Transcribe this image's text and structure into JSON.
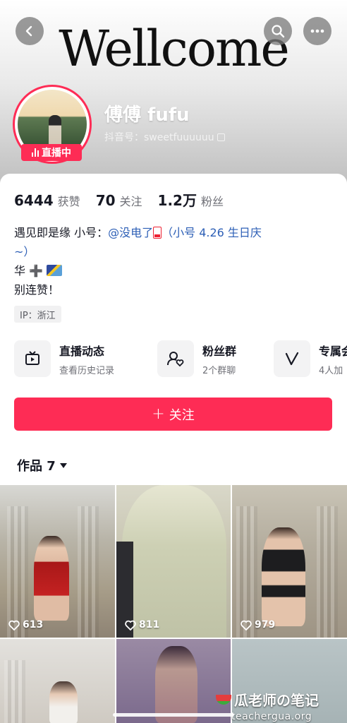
{
  "header": {
    "banner_title": "Wellcome",
    "nickname": "傅傅 fufu",
    "douyin_id": "抖音号：sweetfuuuuuu",
    "live_badge": "直播中"
  },
  "stats": {
    "likes_num": "6444",
    "likes_label": "获赞",
    "following_num": "70",
    "following_label": "关注",
    "followers_num": "1.2万",
    "followers_label": "粉丝"
  },
  "bio": {
    "line1_prefix": "遇见即是缘 小号：",
    "line1_mention": "@没电了",
    "line1_suffix": "（小号 4.26 生日庆",
    "line2": "~）",
    "line3": "华 ➕",
    "line4": "别连赞！"
  },
  "ip_tag": "IP：浙江",
  "features": [
    {
      "title": "直播动态",
      "sub": "查看历史记录"
    },
    {
      "title": "粉丝群",
      "sub": "2个群聊"
    },
    {
      "title": "专属会",
      "sub": "4人加"
    }
  ],
  "follow_button": "关注",
  "works_tab": "作品 7",
  "grid": [
    {
      "likes": "613"
    },
    {
      "likes": "811"
    },
    {
      "likes": "979"
    }
  ],
  "watermark": {
    "line1": "瓜老师の笔记",
    "line2": "teachergua.org"
  },
  "colors": {
    "accent": "#fe2c55",
    "mention": "#2d5fb6"
  }
}
